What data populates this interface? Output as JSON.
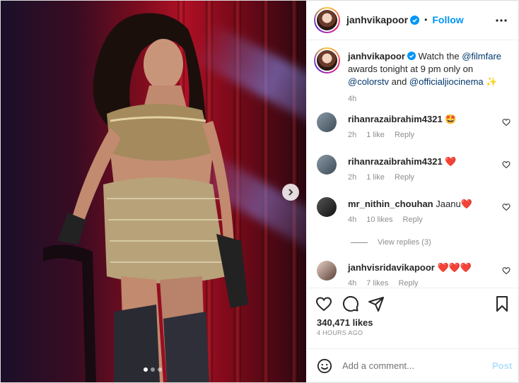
{
  "post": {
    "username": "janhvikapoor",
    "follow_label": "Follow",
    "separator": "•",
    "caption": {
      "username": "janhvikapoor",
      "text_1": "Watch the ",
      "mention_1": "@filmfare",
      "text_2": " awards tonight at 9 pm only on ",
      "mention_2": "@colorstv",
      "text_3": " and ",
      "mention_3": "@officialjiocinema",
      "emoji": "✨",
      "time": "4h"
    },
    "comments": [
      {
        "user": "rihanrazaibrahim4321",
        "text": "🤩",
        "time": "2h",
        "likes": "1 like",
        "reply": "Reply"
      },
      {
        "user": "rihanrazaibrahim4321",
        "text": "❤️",
        "time": "2h",
        "likes": "1 like",
        "reply": "Reply"
      },
      {
        "user": "mr_nithin_chouhan",
        "text": "Jaanu❤️",
        "time": "4h",
        "likes": "10 likes",
        "reply": "Reply"
      },
      {
        "user": "janhvisridavikapoor",
        "text": "❤️❤️❤️",
        "time": "4h",
        "likes": "7 likes",
        "reply": "Reply"
      }
    ],
    "view_replies": "View replies (3)",
    "likes_count": "340,471 likes",
    "posted_ago": "4 HOURS AGO",
    "add_comment_placeholder": "Add a comment...",
    "post_label": "Post",
    "carousel": {
      "dots": 3,
      "active_index": 0
    }
  },
  "colors": {
    "link": "#0095f6",
    "mention": "#00376b",
    "muted": "#8e8e8e",
    "heart": "#ed4956",
    "verified": "#0095f6"
  },
  "icons": [
    "more-icon",
    "like-icon",
    "comment-icon",
    "share-icon",
    "save-icon",
    "emoji-icon",
    "verified-icon",
    "next-icon"
  ]
}
